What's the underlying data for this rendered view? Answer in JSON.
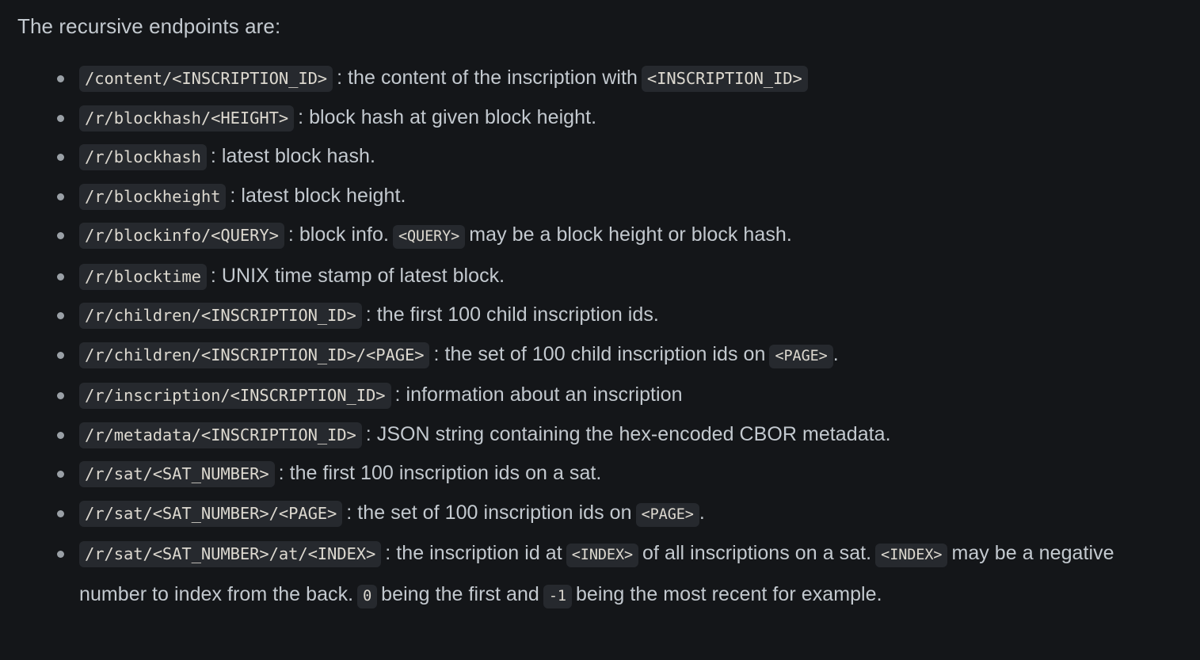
{
  "colors": {
    "background": "#141619",
    "text": "#c3c9cf",
    "code_background": "#26292e",
    "code_text": "#ddd9d0",
    "bullet": "#9aa0a6"
  },
  "intro": "The recursive endpoints are:",
  "endpoints": [
    {
      "path": "/content/<INSCRIPTION_ID>",
      "desc_before": ": the content of the inscription with",
      "inline_code": "<INSCRIPTION_ID>",
      "desc_after": ""
    },
    {
      "path": "/r/blockhash/<HEIGHT>",
      "desc_before": ": block hash at given block height.",
      "inline_code": "",
      "desc_after": ""
    },
    {
      "path": "/r/blockhash",
      "desc_before": ": latest block hash.",
      "inline_code": "",
      "desc_after": ""
    },
    {
      "path": "/r/blockheight",
      "desc_before": ": latest block height.",
      "inline_code": "",
      "desc_after": ""
    },
    {
      "path": "/r/blockinfo/<QUERY>",
      "desc_before": ": block info.",
      "inline_code": "<QUERY>",
      "desc_after": "may be a block height or block hash."
    },
    {
      "path": "/r/blocktime",
      "desc_before": ": UNIX time stamp of latest block.",
      "inline_code": "",
      "desc_after": ""
    },
    {
      "path": "/r/children/<INSCRIPTION_ID>",
      "desc_before": ": the first 100 child inscription ids.",
      "inline_code": "",
      "desc_after": ""
    },
    {
      "path": "/r/children/<INSCRIPTION_ID>/<PAGE>",
      "desc_before": ": the set of 100 child inscription ids on",
      "inline_code": "<PAGE>",
      "desc_after": "."
    },
    {
      "path": "/r/inscription/<INSCRIPTION_ID>",
      "desc_before": ": information about an inscription",
      "inline_code": "",
      "desc_after": ""
    },
    {
      "path": "/r/metadata/<INSCRIPTION_ID>",
      "desc_before": ": JSON string containing the hex-encoded CBOR metadata.",
      "inline_code": "",
      "desc_after": ""
    },
    {
      "path": "/r/sat/<SAT_NUMBER>",
      "desc_before": ": the first 100 inscription ids on a sat.",
      "inline_code": "",
      "desc_after": ""
    },
    {
      "path": "/r/sat/<SAT_NUMBER>/<PAGE>",
      "desc_before": ": the set of 100 inscription ids on",
      "inline_code": "<PAGE>",
      "desc_after": "."
    }
  ],
  "last_endpoint": {
    "path": "/r/sat/<SAT_NUMBER>/at/<INDEX>",
    "seg1": ": the inscription id at",
    "code1": "<INDEX>",
    "seg2": "of all inscriptions on a sat.",
    "code2": "<INDEX>",
    "seg3": "may be a negative number to index from the back.",
    "code3": "0",
    "seg4": "being the first and",
    "code4": "-1",
    "seg5": "being the most recent for example."
  }
}
